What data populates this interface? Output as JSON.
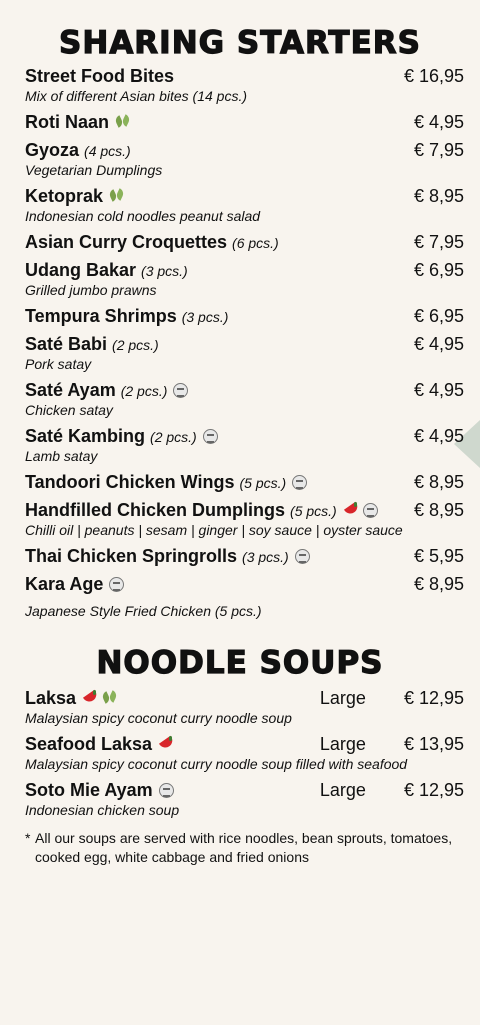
{
  "sharing": {
    "title": "SHARING STARTERS",
    "items": [
      {
        "name": "Street Food Bites",
        "qty": "",
        "price": "€ 16,95",
        "desc": "Mix of different Asian bites (14 pcs.)"
      },
      {
        "name": "Roti Naan",
        "qty": "",
        "price": "€ 4,95",
        "desc": "",
        "icons": [
          "veg"
        ]
      },
      {
        "name": "Gyoza",
        "qty": "(4 pcs.)",
        "price": "€ 7,95",
        "desc": "Vegetarian Dumplings"
      },
      {
        "name": "Ketoprak",
        "qty": "",
        "price": "€ 8,95",
        "desc": "Indonesian cold noodles peanut salad",
        "icons": [
          "veg"
        ]
      },
      {
        "name": "Asian Curry Croquettes",
        "qty": "(6 pcs.)",
        "price": "€ 7,95",
        "desc": ""
      },
      {
        "name": "Udang Bakar",
        "qty": "(3 pcs.)",
        "price": "€ 6,95",
        "desc": "Grilled jumbo prawns"
      },
      {
        "name": "Tempura Shrimps",
        "qty": "(3 pcs.)",
        "price": "€ 6,95",
        "desc": ""
      },
      {
        "name": "Saté Babi",
        "qty": "(2 pcs.)",
        "price": "€ 4,95",
        "desc": "Pork satay"
      },
      {
        "name": "Saté Ayam",
        "qty": "(2 pcs.)",
        "price": "€ 4,95",
        "desc": "Chicken satay",
        "icons": [
          "halal"
        ]
      },
      {
        "name": "Saté Kambing",
        "qty": "(2 pcs.)",
        "price": "€ 4,95",
        "desc": "Lamb satay",
        "icons": [
          "halal"
        ]
      },
      {
        "name": "Tandoori Chicken Wings",
        "qty": "(5 pcs.)",
        "price": "€ 8,95",
        "desc": "",
        "icons": [
          "halal"
        ]
      },
      {
        "name": "Handfilled Chicken Dumplings",
        "qty": "(5 pcs.)",
        "price": "€ 8,95",
        "desc": "Chilli oil | peanuts | sesam | ginger | soy sauce | oyster sauce",
        "icons": [
          "chili",
          "halal"
        ]
      },
      {
        "name": "Thai Chicken Springrolls",
        "qty": "(3 pcs.)",
        "price": "€ 5,95",
        "desc": "",
        "icons": [
          "halal"
        ]
      },
      {
        "name": "Kara Age",
        "qty": "",
        "price": "€ 8,95",
        "desc": "Japanese Style Fried Chicken (5 pcs.)",
        "icons": [
          "halal"
        ]
      }
    ]
  },
  "noodle": {
    "title": "NOODLE SOUPS",
    "items": [
      {
        "name": "Laksa",
        "size": "Large",
        "price": "€ 12,95",
        "desc": "Malaysian spicy coconut curry noodle soup",
        "icons": [
          "chili",
          "veg"
        ]
      },
      {
        "name": "Seafood Laksa",
        "size": "Large",
        "price": "€ 13,95",
        "desc": "Malaysian spicy coconut curry noodle soup filled with seafood",
        "icons": [
          "chili"
        ]
      },
      {
        "name": "Soto Mie Ayam",
        "size": "Large",
        "price": "€ 12,95",
        "desc": "Indonesian chicken soup",
        "icons": [
          "halal"
        ]
      }
    ],
    "note_star": "*",
    "note": "All our soups are served with rice noodles, bean sprouts, tomatoes, cooked egg, white cabbage and fried onions"
  },
  "colors": {
    "background": "#f8f4ee",
    "chili": "#d8262b",
    "veg": "#7aa04a"
  }
}
